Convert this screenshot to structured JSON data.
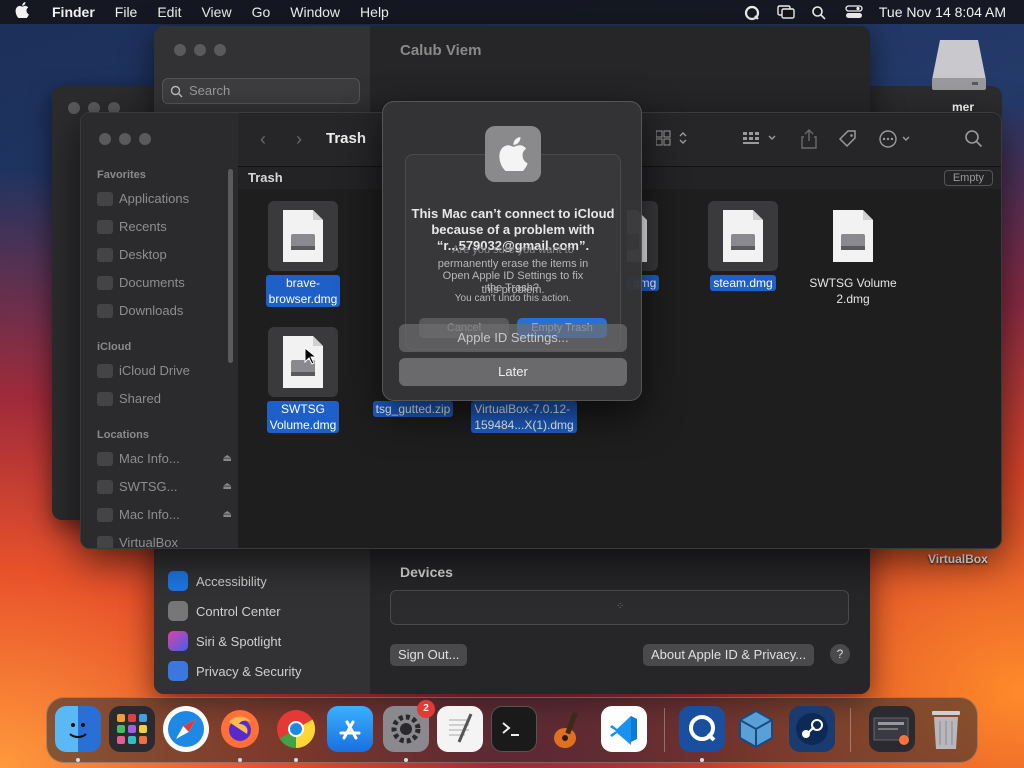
{
  "menubar": {
    "app_name": "Finder",
    "items": [
      "File",
      "Edit",
      "View",
      "Go",
      "Window",
      "Help"
    ],
    "datetime": "Tue Nov 14  8:04 AM"
  },
  "settings_window": {
    "search_placeholder": "Search",
    "title": "Calub Viem",
    "sidebar_items": [
      "Accessibility",
      "Control Center",
      "Siri & Spotlight",
      "Privacy & Security"
    ],
    "devices_label": "Devices",
    "sign_out": "Sign Out...",
    "about": "About Apple ID & Privacy...",
    "help": "?"
  },
  "desktop": {
    "vbox_label": "VirtualBox",
    "disk_label": "mer"
  },
  "finder": {
    "title": "Trash",
    "path": "Trash",
    "empty_button": "Empty",
    "sidebar": {
      "favorites_label": "Favorites",
      "favorites": [
        "Applications",
        "Recents",
        "Desktop",
        "Documents",
        "Downloads"
      ],
      "icloud_label": "iCloud",
      "icloud": [
        "iCloud Drive",
        "Shared"
      ],
      "locations_label": "Locations",
      "locations": [
        "Mac Info...",
        "SWTSG...",
        "Mac Info...",
        "VirtualBox"
      ]
    },
    "files": [
      {
        "name": "brave-\nbrowser.dmg",
        "selected": true
      },
      {
        "name": ".dmg",
        "selected": true
      },
      {
        "name": "steam.dmg",
        "selected": true
      },
      {
        "name": "SWTSG Volume\n2.dmg",
        "selected": false
      },
      {
        "name": "SWTSG\nVolume.dmg",
        "selected": true
      },
      {
        "name": "tsg_gutted.zip",
        "selected": true
      },
      {
        "name": "VirtualBox-7.0.12-\n159484...X(1).dmg",
        "selected": true
      }
    ]
  },
  "dialog": {
    "title": "This Mac can’t connect to iCloud because of a problem with “r...579032@gmail.com”.",
    "ghost_line_1": "Are you sure you want to",
    "ghost_line_2": "permanently erase the items in",
    "ghost_line_3": "Open Apple ID Settings to fix",
    "ghost_line_4": "the Trash?",
    "ghost_line_5": "this problem.",
    "ghost_line_6": "You can’t undo this action.",
    "ghost_cancel": "Cancel",
    "ghost_empty": "Empty Trash",
    "settings_button": "Apple ID Settings...",
    "later_button": "Later"
  },
  "dock": {
    "settings_badge": "2"
  }
}
